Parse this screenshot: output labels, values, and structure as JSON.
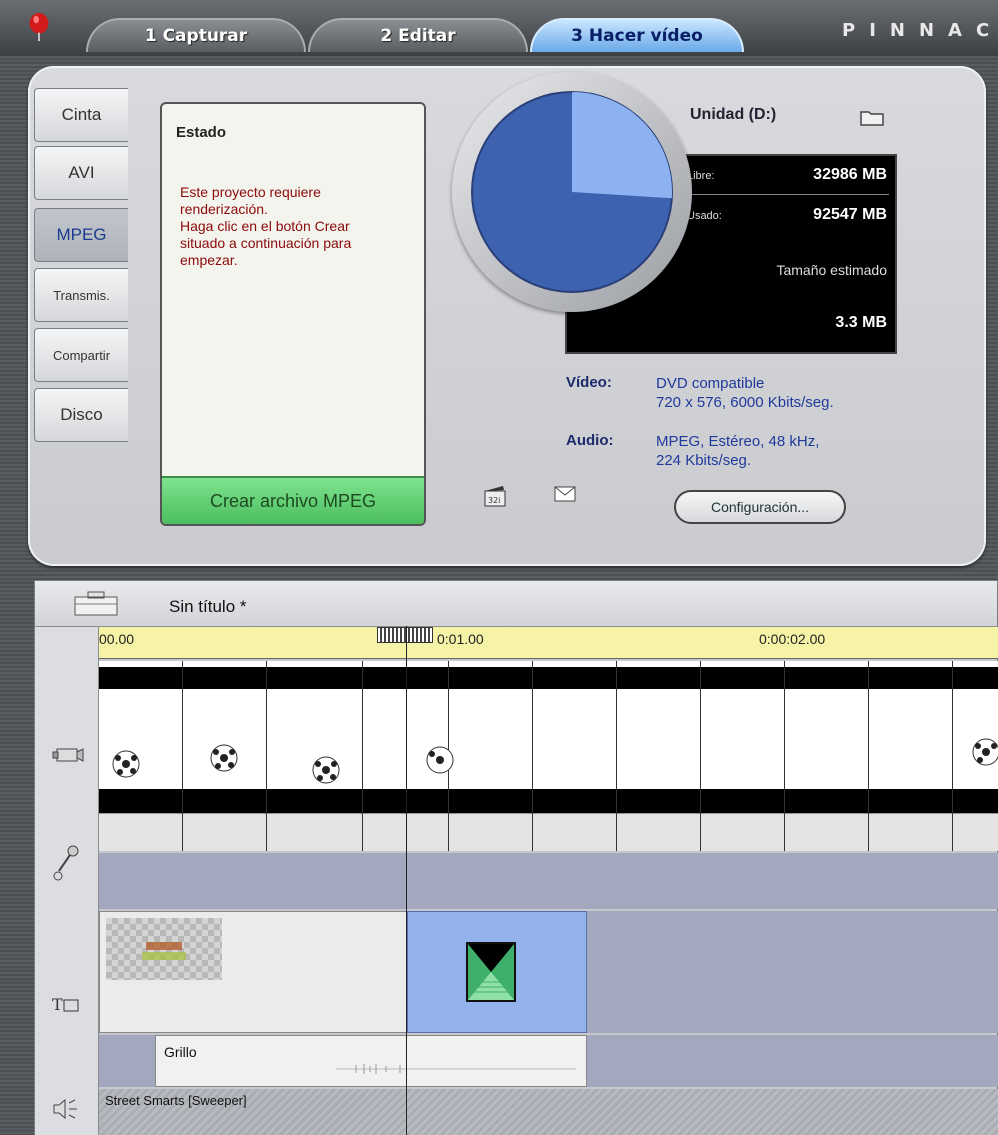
{
  "topbar": {
    "tabs": [
      {
        "label": "1 Capturar"
      },
      {
        "label": "2 Editar"
      },
      {
        "label": "3 Hacer vídeo"
      }
    ],
    "brand": "PINNAC",
    "colors": {
      "active_tab": "#6aa9e8",
      "logo": "#d11a1a"
    }
  },
  "sidebar": {
    "tabs": [
      "Cinta",
      "AVI",
      "MPEG",
      "Transmis.",
      "Compartir",
      "Disco"
    ],
    "active": "MPEG"
  },
  "status": {
    "title": "Estado",
    "message": "Este proyecto requiere\nrenderización.\nHaga clic en el botón Crear\nsituado a continuación para\nempezar.",
    "create_button": "Crear archivo MPEG"
  },
  "disk": {
    "unit_label": "Unidad (D:)",
    "free_label": "Libre:",
    "free_value": "32986 MB",
    "used_label": "Usado:",
    "used_value": "92547 MB",
    "estimated_label": "Tamaño estimado",
    "estimated_value": "3.3 MB",
    "free_fraction": 0.26
  },
  "specs": {
    "video_label": "Vídeo:",
    "video_value": "DVD compatible\n720 x 576, 6000 Kbits/seg.",
    "audio_label": "Audio:",
    "audio_value": "MPEG, Estéreo, 48 kHz,\n224 Kbits/seg.",
    "config_button": "Configuración..."
  },
  "timeline": {
    "project_title": "Sin título *",
    "ruler_labels": [
      "00.00",
      "0:01.00",
      "0:00:02.00"
    ],
    "sfx_clip_label": "Grillo",
    "music_clip_label": "Street Smarts [Sweeper]"
  }
}
